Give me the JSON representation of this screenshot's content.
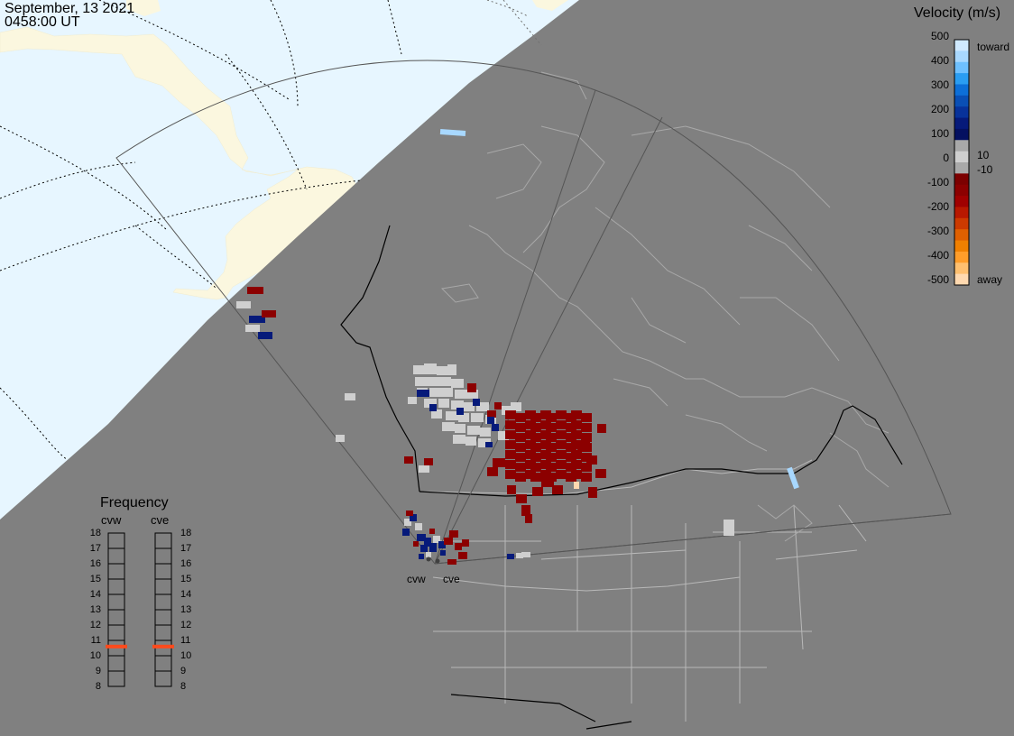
{
  "header": {
    "date": "September, 13 2021",
    "time": "0458:00 UT"
  },
  "colorbar": {
    "title": "Velocity (m/s)",
    "ticks": [
      "500",
      "400",
      "300",
      "200",
      "100",
      "0",
      "-100",
      "-200",
      "-300",
      "-400",
      "-500"
    ],
    "label_toward": "toward",
    "label_away": "away",
    "label_pos": "10",
    "label_neg": "-10",
    "colors": [
      "#cfe9ff",
      "#a8d8ff",
      "#6ec0ff",
      "#2a9df2",
      "#0d6fd8",
      "#0a4fb5",
      "#08329a",
      "#061a7a",
      "#041060",
      "#a9a9a9",
      "#cfcfcf",
      "#a9a9a9",
      "#7c0000",
      "#8c0000",
      "#a00000",
      "#b81800",
      "#cc3a00",
      "#e06000",
      "#f08000",
      "#ff9d2a",
      "#ffc070",
      "#ffd9b0"
    ]
  },
  "frequency": {
    "title": "Frequency",
    "stations": [
      "cvw",
      "cve"
    ],
    "ticks": [
      18,
      17,
      16,
      15,
      14,
      13,
      12,
      11,
      10,
      9,
      8
    ],
    "cvw_value": 10.6,
    "cve_value": 10.6
  },
  "map": {
    "land_color": "#fbf7df",
    "ocean_color": "#e7f6ff",
    "night_color": "#808080",
    "station_labels": [
      "cvw",
      "cve"
    ]
  }
}
